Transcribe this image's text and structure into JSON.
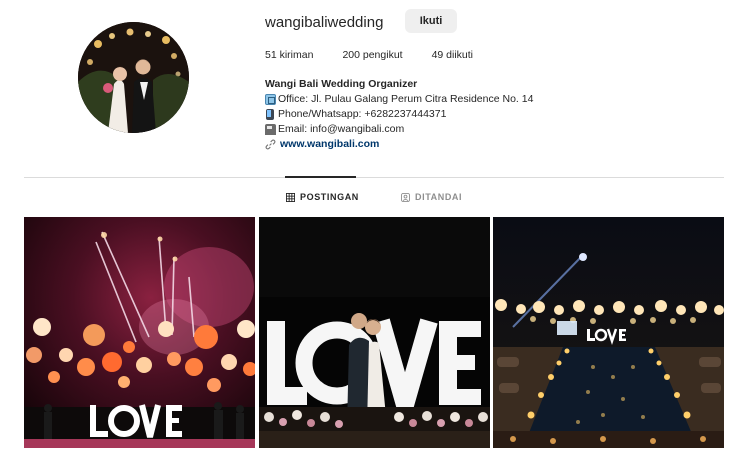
{
  "profile": {
    "username": "wangibaliwedding",
    "follow_label": "Ikuti",
    "avatar_icon": "wedding-couple-photo"
  },
  "stats": {
    "posts": "51 kiriman",
    "followers": "200 pengikut",
    "following": "49 diikuti"
  },
  "bio": {
    "name": "Wangi Bali Wedding Organizer",
    "office": "Office: Jl. Pulau Galang Perum Citra Residence No. 14",
    "phone": "Phone/Whatsapp: +6282237444371",
    "email": "Email: info@wangibali.com",
    "website": "www.wangibali.com",
    "office_icon": "office-emoji",
    "phone_icon": "phone-emoji",
    "email_icon": "mailbox-emoji",
    "link_icon": "link-icon"
  },
  "tabs": [
    {
      "label": "POSTINGAN",
      "icon": "grid-icon",
      "active": true
    },
    {
      "label": "DITANDAI",
      "icon": "tagged-icon",
      "active": false
    }
  ],
  "posts": [
    {
      "caption_text": "LOVE",
      "scene": "fireworks-lanterns"
    },
    {
      "caption_text": "LOVE",
      "scene": "couple-in-front-of-love-letters"
    },
    {
      "caption_text": "LOVE",
      "scene": "poolside-reception-lights"
    }
  ],
  "colors": {
    "link": "#00376b",
    "button_bg": "#efefef",
    "divider": "#dbdbdb",
    "muted": "#8e8e8e"
  }
}
